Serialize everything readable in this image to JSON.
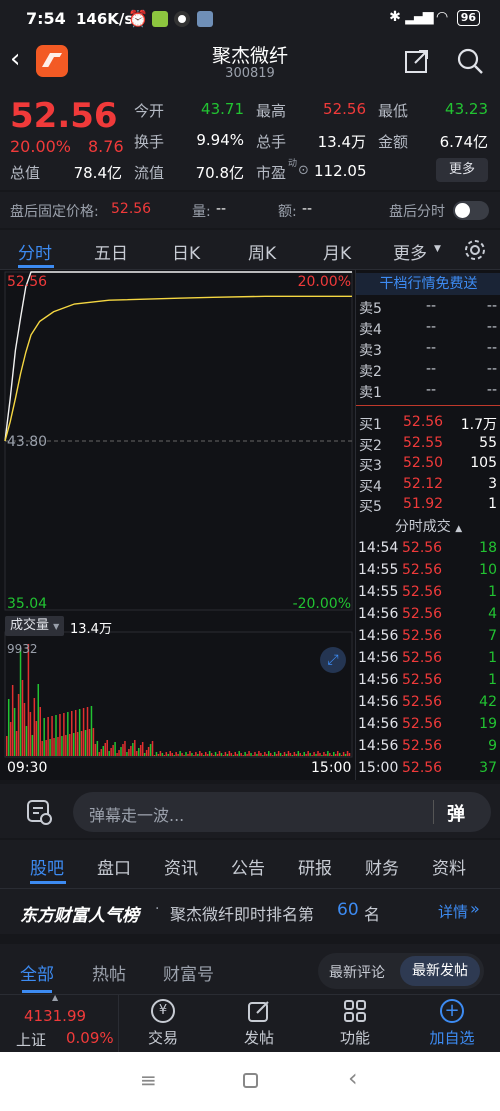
{
  "status_bar": {
    "time": "7:54",
    "net_speed": "146K/s",
    "battery": "96"
  },
  "header": {
    "name": "聚杰微纤",
    "code": "300819"
  },
  "quote": {
    "price": "52.56",
    "change_pct": "20.00%",
    "change_amt": "8.76",
    "fields": [
      {
        "label": "今开",
        "value": "43.71",
        "color": "green"
      },
      {
        "label": "最高",
        "value": "52.56",
        "color": "red"
      },
      {
        "label": "最低",
        "value": "43.23",
        "color": "green"
      },
      {
        "label": "换手",
        "value": "9.94%",
        "color": "white"
      },
      {
        "label": "总手",
        "value": "13.4万",
        "color": "white"
      },
      {
        "label": "金额",
        "value": "6.74亿",
        "color": "white"
      },
      {
        "label": "总值",
        "value": "78.4亿",
        "color": "white"
      },
      {
        "label": "流值",
        "value": "70.8亿",
        "color": "white"
      },
      {
        "label": "市盈",
        "value": "112.05",
        "color": "white"
      }
    ],
    "pe_superscript": "动",
    "more_label": "更多"
  },
  "after_hours": {
    "fixed_label": "盘后固定价格:",
    "fixed_value": "52.56",
    "vol_label": "量:",
    "vol_value": "--",
    "amt_label": "额:",
    "amt_value": "--",
    "tick_label": "盘后分时"
  },
  "chart_tabs": [
    "分时",
    "五日",
    "日K",
    "周K",
    "月K",
    "更多"
  ],
  "chart": {
    "top_left": "52.56",
    "top_right": "20.00%",
    "mid_left": "43.80",
    "bottom_left": "35.04",
    "bottom_right": "-20.00%",
    "volume_label": "成交量",
    "volume_value": "13.4万",
    "volume_max": "9932",
    "time_start": "09:30",
    "time_end": "15:00"
  },
  "chart_data": {
    "type": "line",
    "x": [
      "09:30",
      "09:32",
      "09:34",
      "09:36",
      "09:38",
      "09:40",
      "09:45",
      "09:50",
      "10:00",
      "10:30",
      "11:30",
      "13:30",
      "14:00",
      "15:00"
    ],
    "series": [
      {
        "values": [
          43.8,
          46.0,
          48.5,
          50.2,
          51.8,
          52.56,
          52.56,
          52.56,
          52.56,
          52.56,
          52.56,
          52.56,
          52.56,
          52.56
        ]
      },
      {
        "values": [
          43.8,
          44.8,
          46.0,
          47.3,
          48.4,
          49.3,
          50.0,
          50.5,
          50.9,
          51.1,
          51.2,
          51.25,
          51.3,
          51.3
        ]
      }
    ],
    "ylim": [
      35.04,
      52.56
    ],
    "ticks": [
      "52.56",
      "43.80",
      "35.04"
    ]
  },
  "order_book": {
    "banner": "干档行情免费送",
    "asks": [
      {
        "label": "卖5",
        "price": "--",
        "vol": "--"
      },
      {
        "label": "卖4",
        "price": "--",
        "vol": "--"
      },
      {
        "label": "卖3",
        "price": "--",
        "vol": "--"
      },
      {
        "label": "卖2",
        "price": "--",
        "vol": "--"
      },
      {
        "label": "卖1",
        "price": "--",
        "vol": "--"
      }
    ],
    "bids": [
      {
        "label": "买1",
        "price": "52.56",
        "vol": "1.7万"
      },
      {
        "label": "买2",
        "price": "52.55",
        "vol": "55"
      },
      {
        "label": "买3",
        "price": "52.50",
        "vol": "105"
      },
      {
        "label": "买4",
        "price": "52.12",
        "vol": "3"
      },
      {
        "label": "买5",
        "price": "51.92",
        "vol": "1"
      }
    ],
    "ticks_label": "分时成交",
    "ticks": [
      {
        "time": "14:54",
        "price": "52.56",
        "vol": "18"
      },
      {
        "time": "14:55",
        "price": "52.56",
        "vol": "10"
      },
      {
        "time": "14:55",
        "price": "52.56",
        "vol": "1"
      },
      {
        "time": "14:56",
        "price": "52.56",
        "vol": "4"
      },
      {
        "time": "14:56",
        "price": "52.56",
        "vol": "7"
      },
      {
        "time": "14:56",
        "price": "52.56",
        "vol": "1"
      },
      {
        "time": "14:56",
        "price": "52.56",
        "vol": "1"
      },
      {
        "time": "14:56",
        "price": "52.56",
        "vol": "42"
      },
      {
        "time": "14:56",
        "price": "52.56",
        "vol": "19"
      },
      {
        "time": "14:56",
        "price": "52.56",
        "vol": "9"
      },
      {
        "time": "15:00",
        "price": "52.56",
        "vol": "37"
      }
    ]
  },
  "danmu": {
    "placeholder": "弹幕走一波...",
    "toggle": "弹"
  },
  "sub_tabs": [
    "股吧",
    "盘口",
    "资讯",
    "公告",
    "研报",
    "财务",
    "资料"
  ],
  "rank": {
    "brand": "东方财富人气榜",
    "text_before": "聚杰微纤即时排名第",
    "rank": "60",
    "text_after": "名",
    "detail": "详情"
  },
  "feed_tabs": [
    "全部",
    "热帖",
    "财富号"
  ],
  "feed_sort": [
    "最新评论",
    "最新发帖"
  ],
  "bottom_nav": {
    "index_value": "4131.99",
    "index_name": "上证",
    "index_change": "0.09%",
    "items": [
      "交易",
      "发帖",
      "功能",
      "加自选"
    ]
  },
  "colors": {
    "up": "#f03a3a",
    "down": "#22c332",
    "accent": "#3d8bf2",
    "bg": "#16171b"
  }
}
